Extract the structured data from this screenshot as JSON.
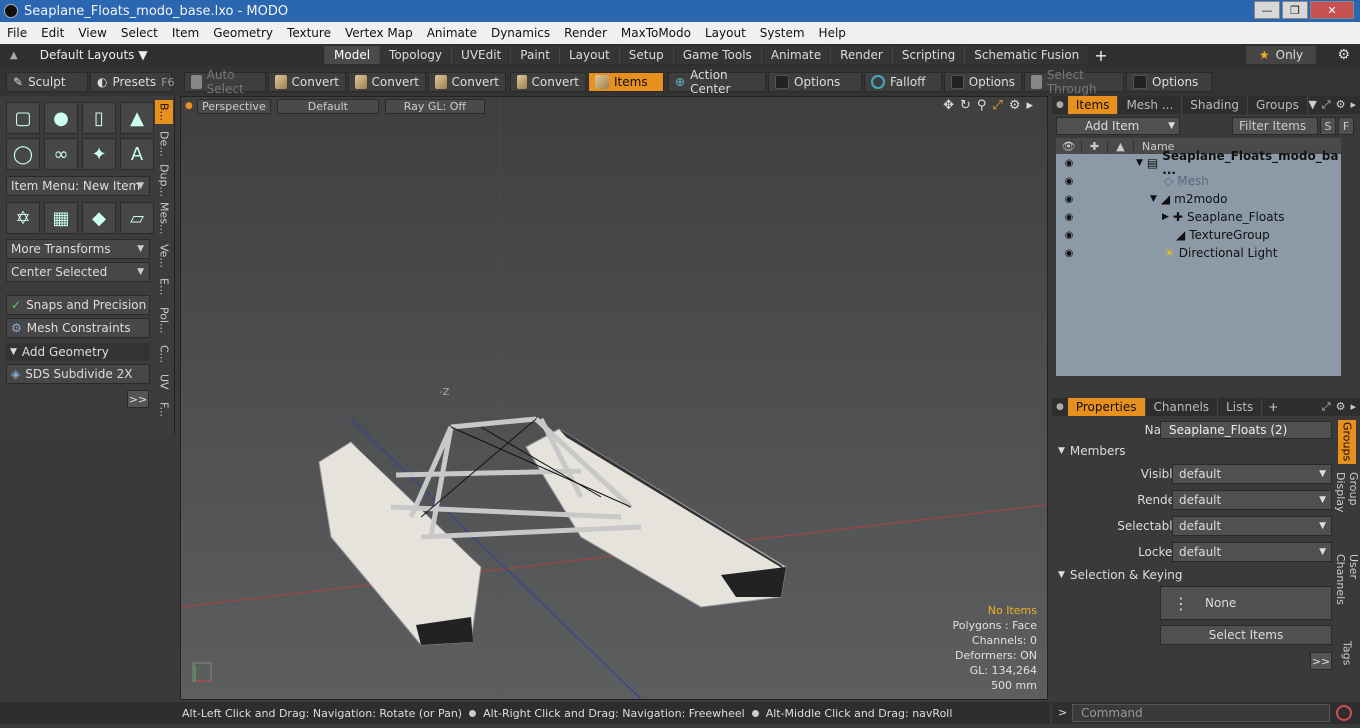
{
  "window": {
    "title": "Seaplane_Floats_modo_base.lxo - MODO"
  },
  "menu": [
    "File",
    "Edit",
    "View",
    "Select",
    "Item",
    "Geometry",
    "Texture",
    "Vertex Map",
    "Animate",
    "Dynamics",
    "Render",
    "MaxToModo",
    "Layout",
    "System",
    "Help"
  ],
  "layout": {
    "preset": "Default Layouts",
    "tabs": [
      "Model",
      "Topology",
      "UVEdit",
      "Paint",
      "Layout",
      "Setup",
      "Game Tools",
      "Animate",
      "Render",
      "Scripting",
      "Schematic Fusion"
    ],
    "active_tab": "Model",
    "only_label": "Only"
  },
  "toolbar": {
    "sculpt": "Sculpt",
    "presets": "Presets",
    "presets_key": "F6",
    "auto_select": "Auto Select",
    "convert1": "Convert",
    "convert2": "Convert",
    "convert3": "Convert",
    "convert4": "Convert",
    "items": "Items",
    "action_center": "Action Center",
    "options1": "Options",
    "falloff": "Falloff",
    "options2": "Options",
    "select_through": "Select Through",
    "options3": "Options"
  },
  "leftpanel": {
    "item_menu": "Item Menu: New Item",
    "more_transforms": "More Transforms",
    "center_selected": "Center Selected",
    "snaps": "Snaps and Precision",
    "mesh_constraints": "Mesh Constraints",
    "add_geometry": "Add Geometry",
    "sds": "SDS Subdivide 2X",
    "more": ">>",
    "sidetabs": [
      "B...",
      "De...",
      "Dup...",
      "Mes...",
      "Ve...",
      "E...",
      "Pol...",
      "C...",
      "UV",
      "F..."
    ]
  },
  "viewport": {
    "view": "Perspective",
    "shading": "Default",
    "raygl": "Ray GL: Off",
    "axis_label": "-Z",
    "info": {
      "items": "No Items",
      "polygons": "Polygons : Face",
      "channels": "Channels: 0",
      "deformers": "Deformers: ON",
      "gl": "GL: 134,264",
      "scale": "500 mm"
    }
  },
  "items_panel": {
    "tabs": [
      "Items",
      "Mesh ...",
      "Shading",
      "Groups"
    ],
    "add_item": "Add Item",
    "filter": "Filter Items",
    "s": "S",
    "f": "F",
    "name_col": "Name",
    "tree": [
      {
        "label": "Seaplane_Floats_modo_ba ...",
        "indent": 0
      },
      {
        "label": "Mesh",
        "indent": 1
      },
      {
        "label": "m2modo",
        "indent": 1
      },
      {
        "label": "Seaplane_Floats",
        "indent": 2
      },
      {
        "label": "TextureGroup",
        "indent": 2
      },
      {
        "label": "Directional Light",
        "indent": 1
      }
    ]
  },
  "properties": {
    "tabs": [
      "Properties",
      "Channels",
      "Lists"
    ],
    "name_label": "Name",
    "name_value": "Seaplane_Floats (2)",
    "members": "Members",
    "visible_label": "Visible",
    "visible": "default",
    "render_label": "Render",
    "render": "default",
    "selectable_label": "Selectable",
    "selectable": "default",
    "locked_label": "Locked",
    "locked": "default",
    "selection_keying": "Selection & Keying",
    "none": "None",
    "select_items": "Select Items",
    "more": ">>",
    "vtabs": [
      "Groups",
      "Group Display",
      "User Channels",
      "Tags"
    ]
  },
  "status": {
    "hint1": "Alt-Left Click and Drag: Navigation: Rotate (or Pan)",
    "hint2": "Alt-Right Click and Drag: Navigation: Freewheel",
    "hint3": "Alt-Middle Click and Drag: navRoll"
  },
  "command": {
    "placeholder": "Command"
  }
}
